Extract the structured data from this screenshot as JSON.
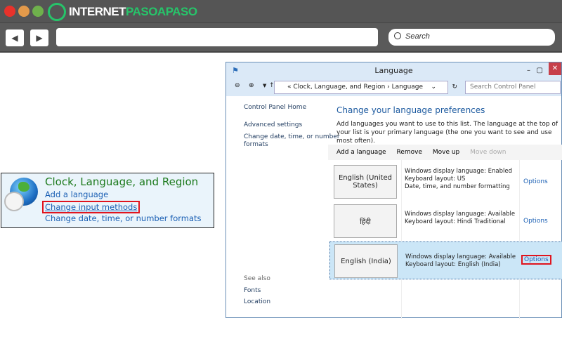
{
  "browser": {
    "logo_text_white": "INTERNET",
    "logo_text_green": "PASOAPASO",
    "search_placeholder": "Search",
    "back_icon": "◀",
    "forward_icon": "▶"
  },
  "control_panel_tile": {
    "title": "Clock, Language, and Region",
    "links": [
      "Add a language",
      "Change input methods",
      "Change date, time, or number formats"
    ]
  },
  "window": {
    "title": "Language",
    "breadcrumb": [
      "Clock, Language, and Region",
      "Language"
    ],
    "search_placeholder": "Search Control Panel",
    "sidebar": {
      "items": [
        "Control Panel Home",
        "Advanced settings",
        "Change date, time, or number",
        "formats"
      ],
      "see_also_label": "See also",
      "see_also": [
        "Fonts",
        "Location"
      ]
    },
    "main_title": "Change your language preferences",
    "description": "Add languages you want to use to this list. The language at the top of your list is your primary language (the one you want to see and use most often).",
    "toolbar": [
      "Add a language",
      "Remove",
      "Move up",
      "Move down"
    ],
    "languages": [
      {
        "name": "English (United States)",
        "info": [
          "Windows display language: Enabled",
          "Keyboard layout: US",
          "Date, time, and number formatting"
        ],
        "options": "Options"
      },
      {
        "name": "हिंदी",
        "info": [
          "Windows display language: Available",
          "Keyboard layout: Hindi Traditional"
        ],
        "options": "Options"
      },
      {
        "name": "English (India)",
        "info": [
          "Windows display language: Available",
          "Keyboard layout: English (India)"
        ],
        "options": "Options"
      }
    ]
  },
  "colors": {
    "highlight": "#e0141e",
    "link": "#1a5fb4",
    "brand_green": "#27c46a"
  }
}
